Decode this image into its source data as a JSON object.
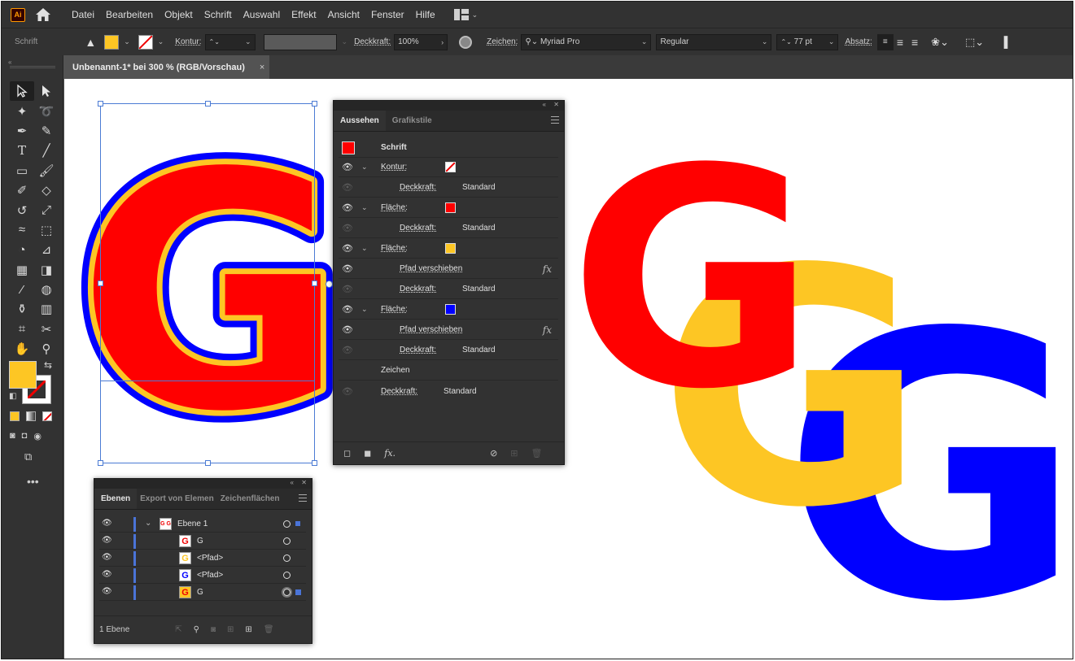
{
  "menubar": {
    "logo": "Ai",
    "items": [
      "Datei",
      "Bearbeiten",
      "Objekt",
      "Schrift",
      "Auswahl",
      "Effekt",
      "Ansicht",
      "Fenster",
      "Hilfe"
    ]
  },
  "control": {
    "selection_label": "Schrift",
    "kontur_label": "Kontur:",
    "deckkraft_label": "Deckkraft:",
    "deckkraft_value": "100%",
    "zeichen_label": "Zeichen:",
    "font_family": "Myriad Pro",
    "font_style": "Regular",
    "font_size": "77 pt",
    "absatz_label": "Absatz:"
  },
  "document": {
    "tab_title": "Unbenannt-1* bei 300 % (RGB/Vorschau)",
    "close": "×"
  },
  "aussehen": {
    "tabs": [
      "Aussehen",
      "Grafikstile"
    ],
    "title": "Schrift",
    "rows": [
      {
        "label": "Kontur:",
        "value": ""
      },
      {
        "label": "Deckkraft:",
        "value": "Standard"
      },
      {
        "label": "Fläche:",
        "value": ""
      },
      {
        "label": "Deckkraft:",
        "value": "Standard"
      },
      {
        "label": "Fläche:",
        "value": ""
      },
      {
        "label": "Pfad verschieben",
        "value": "fx"
      },
      {
        "label": "Deckkraft:",
        "value": "Standard"
      },
      {
        "label": "Fläche:",
        "value": ""
      },
      {
        "label": "Pfad verschieben",
        "value": "fx"
      },
      {
        "label": "Deckkraft:",
        "value": "Standard"
      },
      {
        "label": "Zeichen",
        "value": ""
      },
      {
        "label": "Deckkraft:",
        "value": "Standard"
      }
    ],
    "footer_fx": "fx."
  },
  "ebenen": {
    "tabs": [
      "Ebenen",
      "Export von Elemen",
      "Zeichenflächen"
    ],
    "layers": [
      {
        "name": "Ebene 1",
        "thumb": "G G"
      },
      {
        "name": "G",
        "thumb": "G"
      },
      {
        "name": "<Pfad>",
        "thumb": "G"
      },
      {
        "name": "<Pfad>",
        "thumb": "G"
      },
      {
        "name": "G",
        "thumb": "G"
      }
    ],
    "footer": "1 Ebene"
  },
  "canvas": {
    "letter": "G"
  },
  "colors": {
    "red": "#ff0000",
    "yellow": "#fdc624",
    "blue": "#0000ff",
    "selection": "#4b7bd4"
  },
  "icons": [
    "home-icon",
    "workspace-icon",
    "selection-tool-icon",
    "direct-selection-tool-icon",
    "eye-icon",
    "fx-icon",
    "hamburger-menu-icon",
    "search-icon",
    "trash-icon"
  ]
}
